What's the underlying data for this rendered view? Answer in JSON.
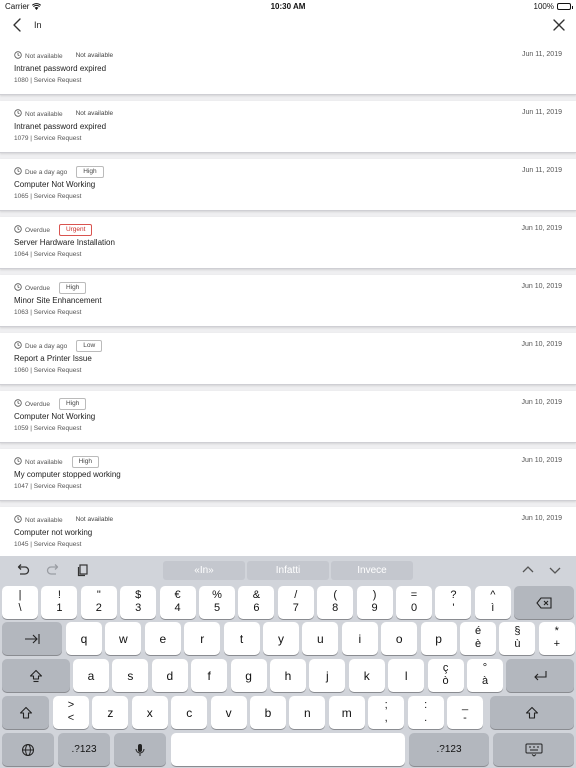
{
  "status_bar": {
    "carrier": "Carrier",
    "time": "10:30 AM",
    "battery": "100%"
  },
  "search": {
    "value": "In"
  },
  "tickets": [
    {
      "status": "Not available",
      "priority": "Not available",
      "priority_style": "plain",
      "date": "Jun 11, 2019",
      "title": "Intranet password expired",
      "sub": "1080 | Service Request"
    },
    {
      "status": "Not available",
      "priority": "Not available",
      "priority_style": "plain",
      "date": "Jun 11, 2019",
      "title": "Intranet password expired",
      "sub": "1079 | Service Request"
    },
    {
      "status": "Due a day ago",
      "priority": "High",
      "priority_style": "boxed",
      "date": "Jun 11, 2019",
      "title": "Computer Not Working",
      "sub": "1065 | Service Request"
    },
    {
      "status": "Overdue",
      "priority": "Urgent",
      "priority_style": "urgent",
      "date": "Jun 10, 2019",
      "title": "Server Hardware Installation",
      "sub": "1064 | Service Request"
    },
    {
      "status": "Overdue",
      "priority": "High",
      "priority_style": "boxed",
      "date": "Jun 10, 2019",
      "title": "Minor Site Enhancement",
      "sub": "1063 | Service Request"
    },
    {
      "status": "Due a day ago",
      "priority": "Low",
      "priority_style": "boxed",
      "date": "Jun 10, 2019",
      "title": "Report a Printer Issue",
      "sub": "1060 | Service Request"
    },
    {
      "status": "Overdue",
      "priority": "High",
      "priority_style": "boxed",
      "date": "Jun 10, 2019",
      "title": "Computer Not Working",
      "sub": "1059 | Service Request"
    },
    {
      "status": "Not available",
      "priority": "High",
      "priority_style": "boxed",
      "date": "Jun 10, 2019",
      "title": "My computer stopped working",
      "sub": "1047 | Service Request"
    },
    {
      "status": "Not available",
      "priority": "Not available",
      "priority_style": "plain",
      "date": "Jun 10, 2019",
      "title": "Computer not working",
      "sub": "1045 | Service Request"
    }
  ],
  "keyboard": {
    "suggestions": [
      "«In»",
      "Infatti",
      "Invece"
    ],
    "row1": [
      {
        "top": "|",
        "bot": "\\"
      },
      {
        "top": "!",
        "bot": "1"
      },
      {
        "top": "\"",
        "bot": "2"
      },
      {
        "top": "$",
        "bot": "3"
      },
      {
        "top": "€",
        "bot": "4"
      },
      {
        "top": "%",
        "bot": "5"
      },
      {
        "top": "&",
        "bot": "6"
      },
      {
        "top": "/",
        "bot": "7"
      },
      {
        "top": "(",
        "bot": "8"
      },
      {
        "top": ")",
        "bot": "9"
      },
      {
        "top": "=",
        "bot": "0"
      },
      {
        "top": "?",
        "bot": "'"
      },
      {
        "top": "^",
        "bot": "ì"
      }
    ],
    "row2": [
      {
        "one": "q"
      },
      {
        "one": "w"
      },
      {
        "one": "e"
      },
      {
        "one": "r"
      },
      {
        "one": "t"
      },
      {
        "one": "y"
      },
      {
        "one": "u"
      },
      {
        "one": "i"
      },
      {
        "one": "o"
      },
      {
        "one": "p"
      },
      {
        "top": "é",
        "bot": "è"
      },
      {
        "top": "§",
        "bot": "ù"
      },
      {
        "top": "*",
        "bot": "+"
      }
    ],
    "row3": [
      {
        "one": "a"
      },
      {
        "one": "s"
      },
      {
        "one": "d"
      },
      {
        "one": "f"
      },
      {
        "one": "g"
      },
      {
        "one": "h"
      },
      {
        "one": "j"
      },
      {
        "one": "k"
      },
      {
        "one": "l"
      },
      {
        "top": "ç",
        "bot": "ò"
      },
      {
        "top": "°",
        "bot": "à"
      }
    ],
    "row4": [
      {
        "top": ">",
        "bot": "<"
      },
      {
        "one": "z"
      },
      {
        "one": "x"
      },
      {
        "one": "c"
      },
      {
        "one": "v"
      },
      {
        "one": "b"
      },
      {
        "one": "n"
      },
      {
        "one": "m"
      },
      {
        "top": ";",
        "bot": ","
      },
      {
        "top": ":",
        "bot": "."
      },
      {
        "top": "_",
        "bot": "-"
      }
    ],
    "numbers_label": ".?123"
  }
}
